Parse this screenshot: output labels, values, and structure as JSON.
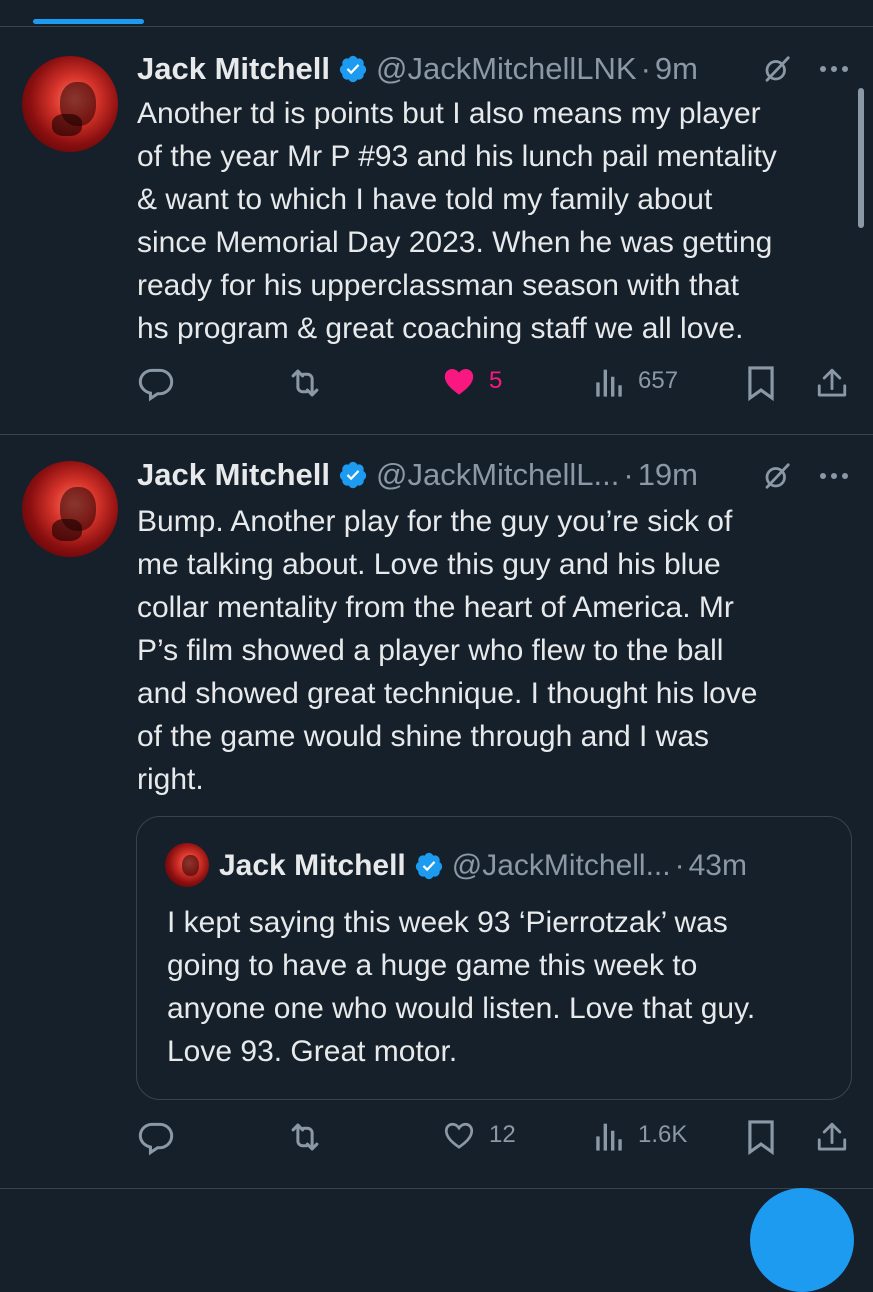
{
  "tweet1": {
    "author_name": "Jack Mitchell",
    "handle": "@JackMitchellLNK",
    "separator": "·",
    "time": "9m",
    "text": "Another td is points but I also means my player\nof the year Mr P #93 and his lunch pail mentality\n& want to which I have told my family about\nsince Memorial Day 2023. When he was getting\nready for his upperclassman season with that\nhs program & great coaching staff we all love.",
    "likes": "5",
    "views": "657",
    "liked": true
  },
  "tweet2": {
    "author_name": "Jack Mitchell",
    "handle": "@JackMitchellL...",
    "separator": "·",
    "time": "19m",
    "text": "Bump. Another play for the guy you’re sick of\nme talking about. Love this guy and his blue\ncollar mentality from the heart of America. Mr\nP’s film showed a player who flew to the ball\nand showed great technique. I thought his love\nof the game would shine through and I was\nright.",
    "likes": "12",
    "views": "1.6K",
    "liked": false,
    "quote": {
      "author_name": "Jack Mitchell",
      "handle": "@JackMitchell...",
      "separator": "·",
      "time": "43m",
      "text": "I kept saying this week 93 ‘Pierrotzak’ was\ngoing to have a huge game this week to\nanyone one who would listen. Love that guy.\nLove 93. Great motor."
    }
  },
  "icons": {
    "verified": "verified-badge-icon",
    "grok": "grok-icon",
    "more": "more-icon",
    "reply": "reply-icon",
    "retweet": "retweet-icon",
    "like": "heart-icon",
    "views": "views-icon",
    "bookmark": "bookmark-icon",
    "share": "share-icon"
  },
  "colors": {
    "background": "#15202b",
    "text": "#e7e9ea",
    "muted": "#8b98a5",
    "accent": "#1d9bf0",
    "like": "#f91880",
    "border": "#38444d"
  }
}
